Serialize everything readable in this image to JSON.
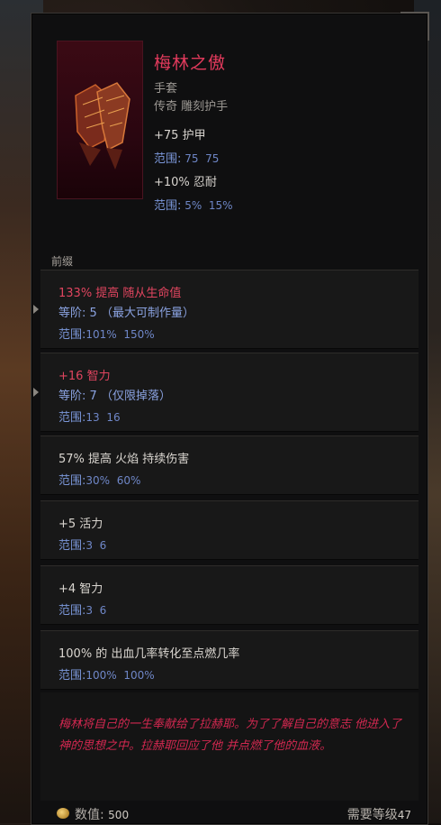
{
  "item": {
    "name": "梅林之傲",
    "type": "手套",
    "rarity_base": "传奇 雕刻护手",
    "image_icon": "gauntlets-icon",
    "implicits": [
      {
        "stat": "+75 护甲",
        "range_label": "范围:",
        "range_min": "75",
        "range_max": "75"
      },
      {
        "stat": "+10% 忍耐",
        "range_label": "范围:",
        "range_min": "5%",
        "range_max": "15%"
      }
    ]
  },
  "section_label": "前缀",
  "affixes": [
    {
      "stat": "133% 提高 随从生命值",
      "color": "red",
      "tier_label": "等阶:",
      "tier_value": "5",
      "tier_note": "（最大可制作量）",
      "range_label": "范围:",
      "range_min": "101%",
      "range_max": "150%"
    },
    {
      "stat": "+16 智力",
      "color": "red",
      "tier_label": "等阶:",
      "tier_value": "7",
      "tier_note": "（仅限掉落）",
      "range_label": "范围:",
      "range_min": "13",
      "range_max": "16"
    },
    {
      "stat": "57% 提高 火焰 持续伤害",
      "color": "white",
      "range_label": "范围:",
      "range_min": "30%",
      "range_max": "60%"
    },
    {
      "stat": "+5 活力",
      "color": "white",
      "range_label": "范围:",
      "range_min": "3",
      "range_max": "6"
    },
    {
      "stat": "+4 智力",
      "color": "white",
      "range_label": "范围:",
      "range_min": "3",
      "range_max": "6"
    },
    {
      "stat": "100% 的 出血几率转化至点燃几率",
      "color": "white",
      "range_label": "范围:",
      "range_min": "100%",
      "range_max": "100%"
    }
  ],
  "lore": "梅林将自己的一生奉献给了拉赫耶。为了了解自己的意志 他进入了神的思想之中。拉赫耶回应了他 并点燃了他的血液。",
  "footer": {
    "value_label": "数值:",
    "value": "500",
    "req_label": "需要等级",
    "req_value": "47",
    "coin_icon": "gold-coin-icon"
  },
  "colors": {
    "unique_name": "#e23a5c",
    "sealed_affix": "#e0455f",
    "range_blue": "#6e86c6",
    "lore": "#d22850"
  }
}
